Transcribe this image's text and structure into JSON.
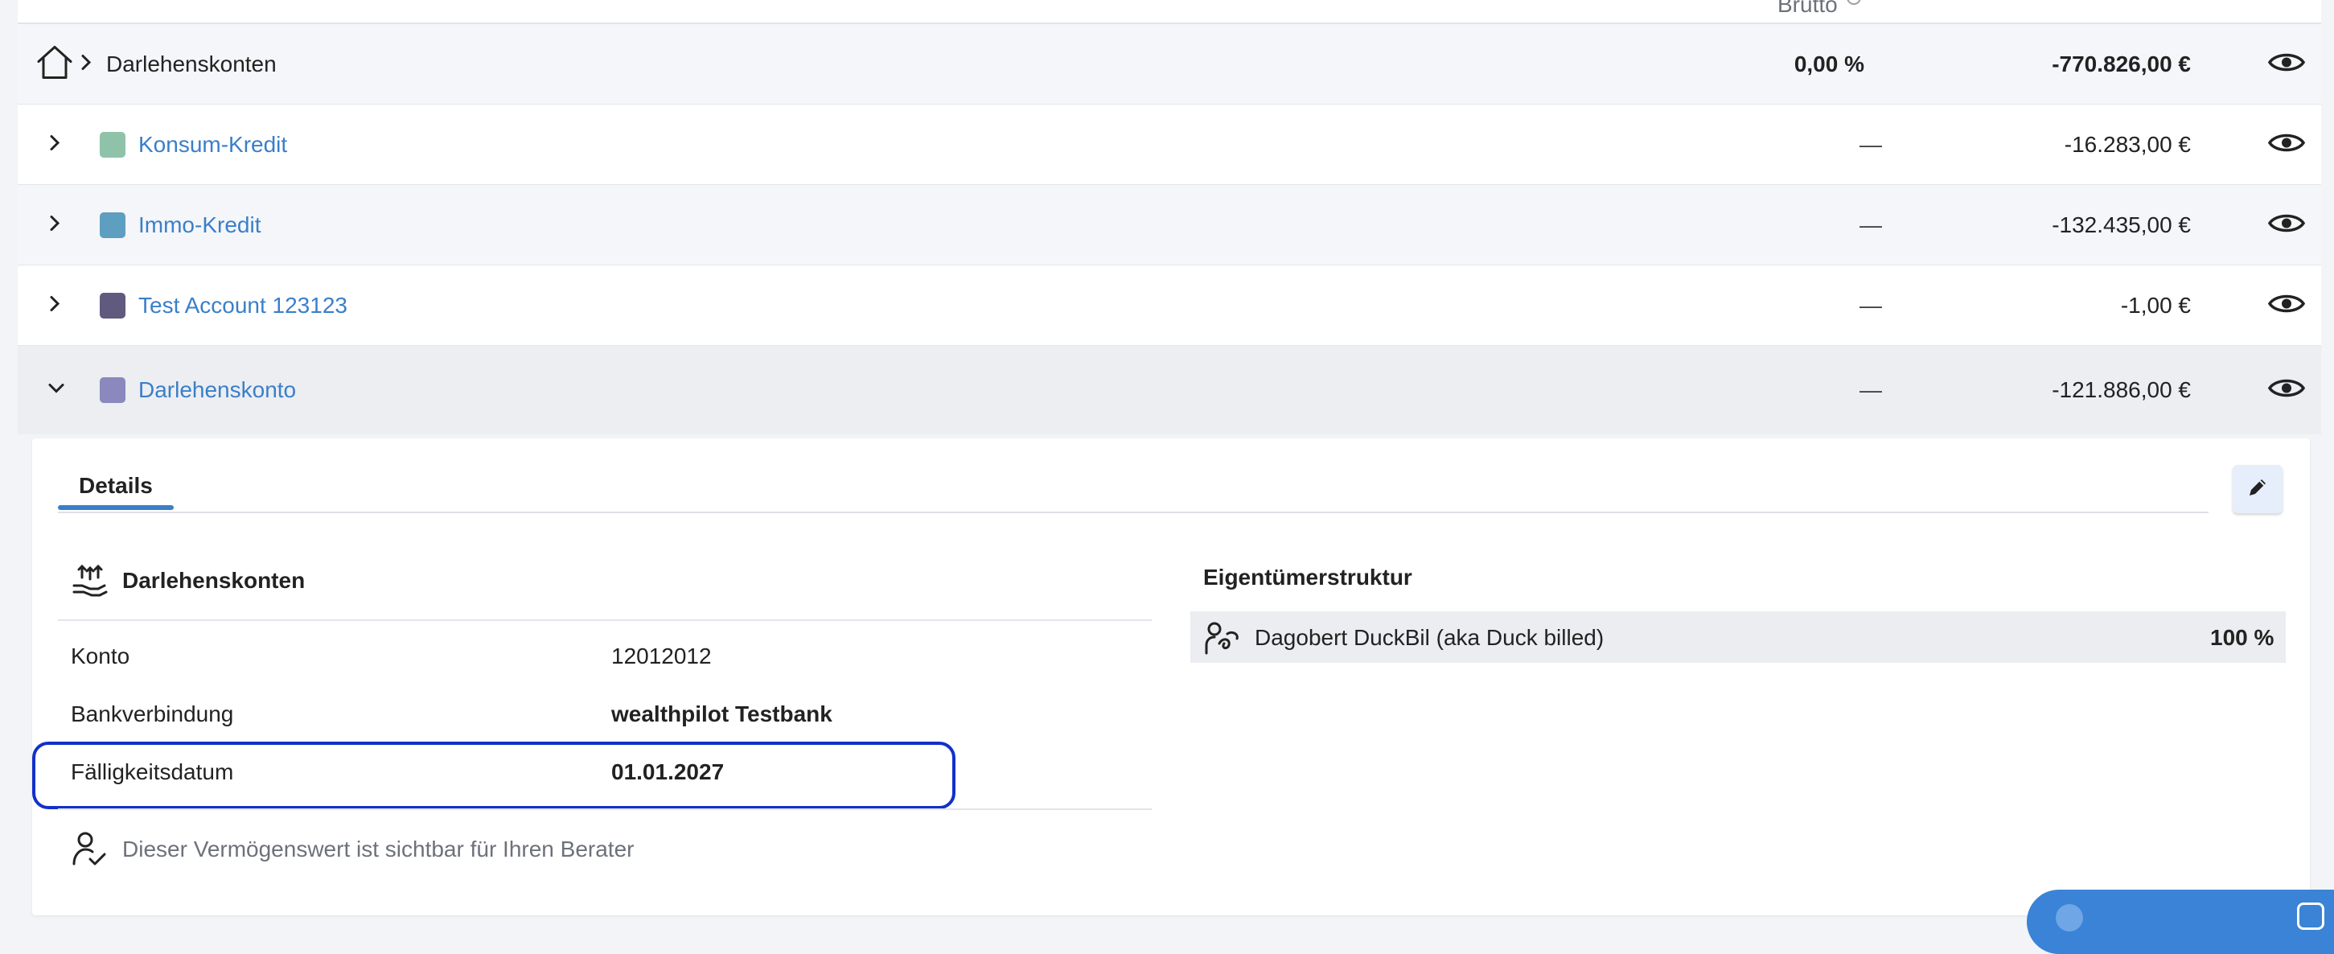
{
  "header": {
    "column_brutto": "Brutto"
  },
  "group": {
    "title": "Darlehenskonten",
    "percent": "0,00 %",
    "total": "-770.826,00 €"
  },
  "accounts": [
    {
      "name": "Konsum-Kredit",
      "percent": "—",
      "amount": "-16.283,00 €",
      "color": "#8fc3a9"
    },
    {
      "name": "Immo-Kredit",
      "percent": "—",
      "amount": "-132.435,00 €",
      "color": "#5e9ec0"
    },
    {
      "name": "Test Account 123123",
      "percent": "—",
      "amount": "-1,00 €",
      "color": "#5f5a7e"
    },
    {
      "name": "Darlehenskonto",
      "percent": "—",
      "amount": "-121.886,00 €",
      "color": "#8a88bd"
    }
  ],
  "details": {
    "tab_label": "Details",
    "section_title": "Darlehenskonten",
    "fields": [
      {
        "label": "Konto",
        "value": "12012012"
      },
      {
        "label": "Bankverbindung",
        "value": "wealthpilot Testbank"
      },
      {
        "label": "Fälligkeitsdatum",
        "value": "01.01.2027"
      }
    ],
    "advisor_note": "Dieser Vermögenswert ist sichtbar für Ihren Berater"
  },
  "ownership": {
    "title": "Eigentümerstruktur",
    "owners": [
      {
        "name": "Dagobert DuckBil (aka Duck billed)",
        "share": "100 %"
      }
    ]
  },
  "colors": {
    "link": "#3a7fc9",
    "highlight_border": "#1330c9",
    "accent_blue": "#3a83d6"
  }
}
